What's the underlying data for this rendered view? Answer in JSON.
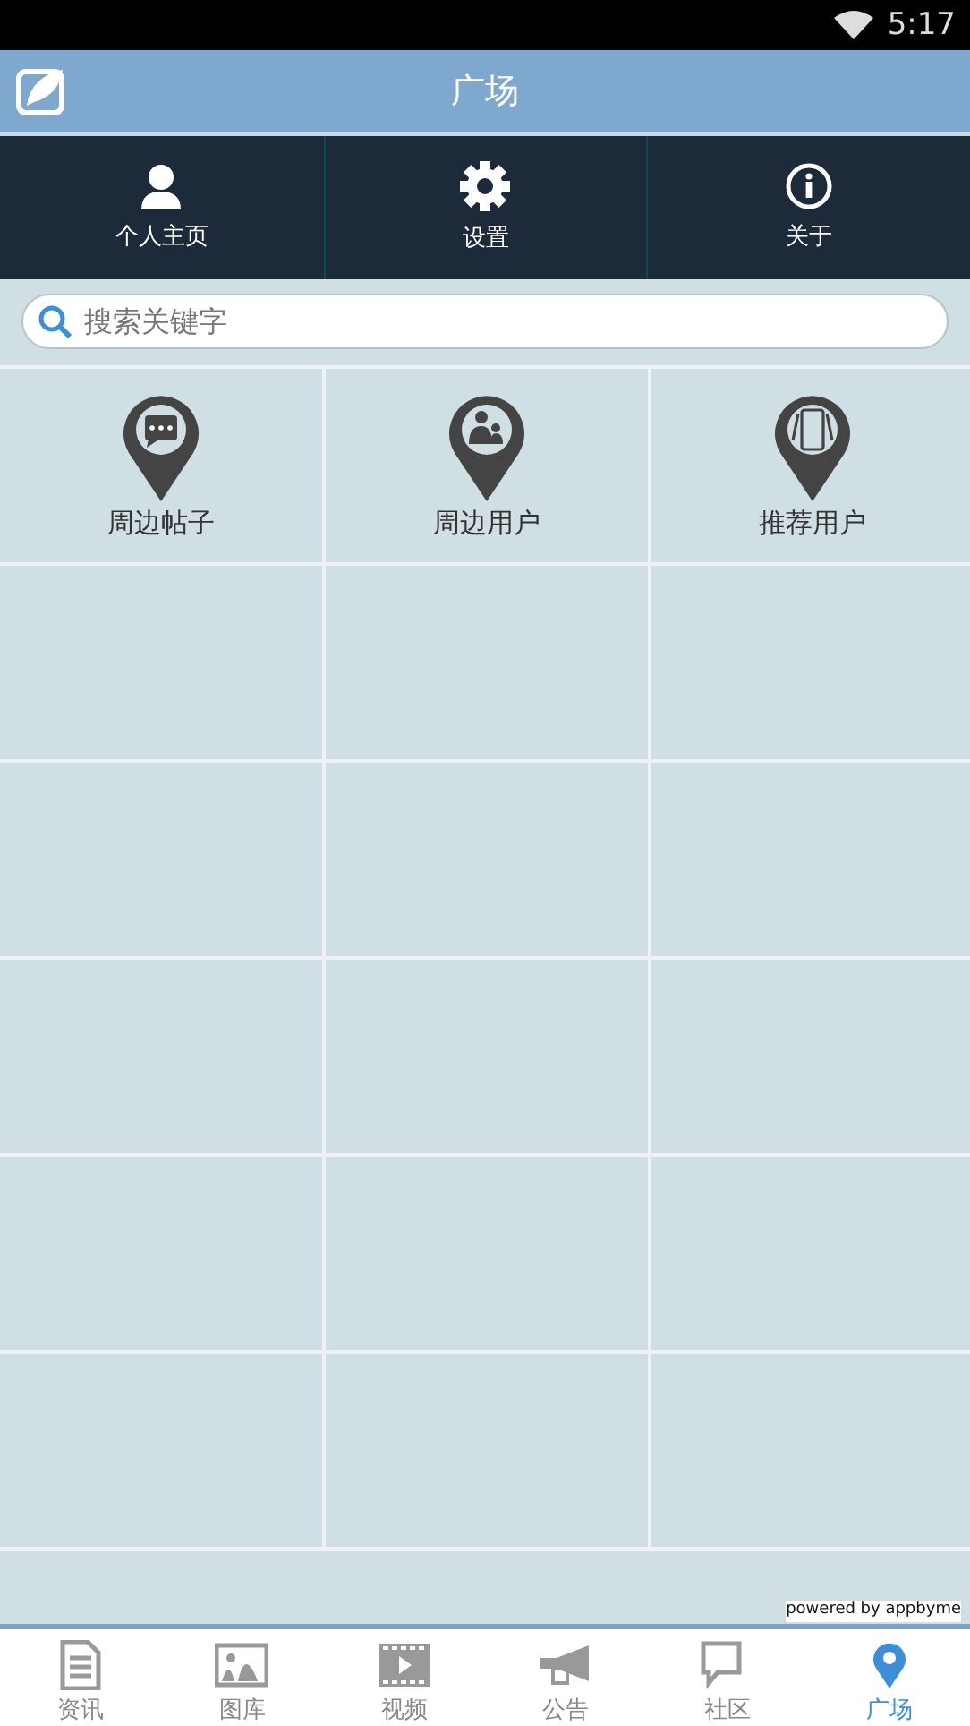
{
  "status_bar": {
    "time": "5:17"
  },
  "header": {
    "title": "广场"
  },
  "menu": [
    {
      "label": "个人主页",
      "kind": "person"
    },
    {
      "label": "设置",
      "kind": "gear"
    },
    {
      "label": "关于",
      "kind": "info"
    }
  ],
  "search": {
    "placeholder": "搜索关键字"
  },
  "grid": [
    {
      "label": "周边帖子",
      "kind": "chat"
    },
    {
      "label": "周边用户",
      "kind": "users"
    },
    {
      "label": "推荐用户",
      "kind": "phones"
    }
  ],
  "footer_note": "powered by appbyme",
  "tabs": [
    {
      "label": "资讯",
      "kind": "doc",
      "selected": false
    },
    {
      "label": "图库",
      "kind": "image",
      "selected": false
    },
    {
      "label": "视频",
      "kind": "video",
      "selected": false
    },
    {
      "label": "公告",
      "kind": "horn",
      "selected": false
    },
    {
      "label": "社区",
      "kind": "bubble",
      "selected": false
    },
    {
      "label": "广场",
      "kind": "square",
      "selected": true
    }
  ]
}
